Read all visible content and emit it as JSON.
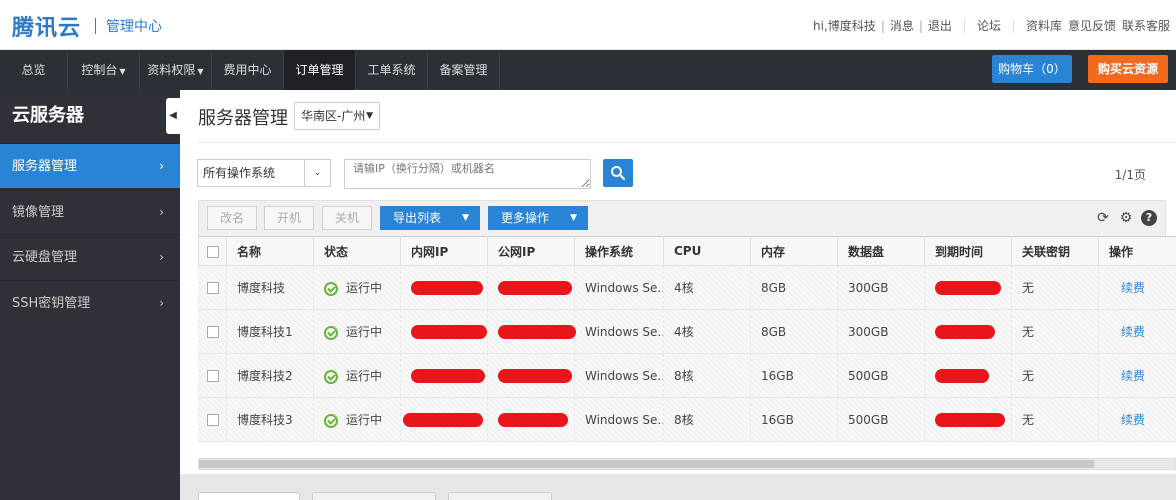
{
  "header": {
    "brand": "腾讯云",
    "subtitle": "管理中心",
    "greeting": "hi,博度科技",
    "messages": "消息",
    "logout": "退出",
    "forum": "论坛",
    "docs": "资料库",
    "feedback": "意见反馈",
    "contact": "联系客服"
  },
  "nav": {
    "items": [
      {
        "label": "总览"
      },
      {
        "label": "控制台"
      },
      {
        "label": "资料权限"
      },
      {
        "label": "费用中心"
      },
      {
        "label": "订单管理"
      },
      {
        "label": "工单系统"
      },
      {
        "label": "备案管理"
      }
    ],
    "cart_label": "购物车（0）",
    "buy_label": "购买云资源"
  },
  "sidebar": {
    "title": "云服务器",
    "items": [
      {
        "label": "服务器管理"
      },
      {
        "label": "镜像管理"
      },
      {
        "label": "云硬盘管理"
      },
      {
        "label": "SSH密钥管理"
      }
    ]
  },
  "main": {
    "title": "服务器管理",
    "region": "华南区-广州",
    "os_filter": "所有操作系统",
    "search_placeholder": "请输IP（换行分隔）或机器名",
    "pager": "1/1页"
  },
  "toolbar": {
    "rename": "改名",
    "start": "开机",
    "shutdown": "关机",
    "export": "导出列表",
    "more": "更多操作"
  },
  "table": {
    "headers": [
      "名称",
      "状态",
      "内网IP",
      "公网IP",
      "操作系统",
      "CPU",
      "内存",
      "数据盘",
      "到期时间",
      "关联密钥",
      "操作"
    ],
    "rows": [
      {
        "name": "博度科技",
        "status": "运行中",
        "os": "Windows Se...",
        "cpu": "4核",
        "mem": "8GB",
        "disk": "300GB",
        "key": "无",
        "action": "续费"
      },
      {
        "name": "博度科技1",
        "status": "运行中",
        "os": "Windows Se...",
        "cpu": "4核",
        "mem": "8GB",
        "disk": "300GB",
        "key": "无",
        "action": "续费"
      },
      {
        "name": "博度科技2",
        "status": "运行中",
        "os": "Windows Se...",
        "cpu": "8核",
        "mem": "16GB",
        "disk": "500GB",
        "key": "无",
        "action": "续费"
      },
      {
        "name": "博度科技3",
        "status": "运行中",
        "os": "Windows Se...",
        "cpu": "8核",
        "mem": "16GB",
        "disk": "500GB",
        "key": "无",
        "action": "续费"
      }
    ]
  },
  "colors": {
    "accent": "#2a84d6",
    "buy": "#f26a1b",
    "nav_bg": "#2b2f36",
    "running": "#67b53a",
    "redaction": "#e8161a"
  },
  "icons": {
    "refresh": "refresh-icon",
    "settings": "gear-icon",
    "help": "help-icon",
    "search": "search-icon",
    "status": "check-circle-icon"
  }
}
